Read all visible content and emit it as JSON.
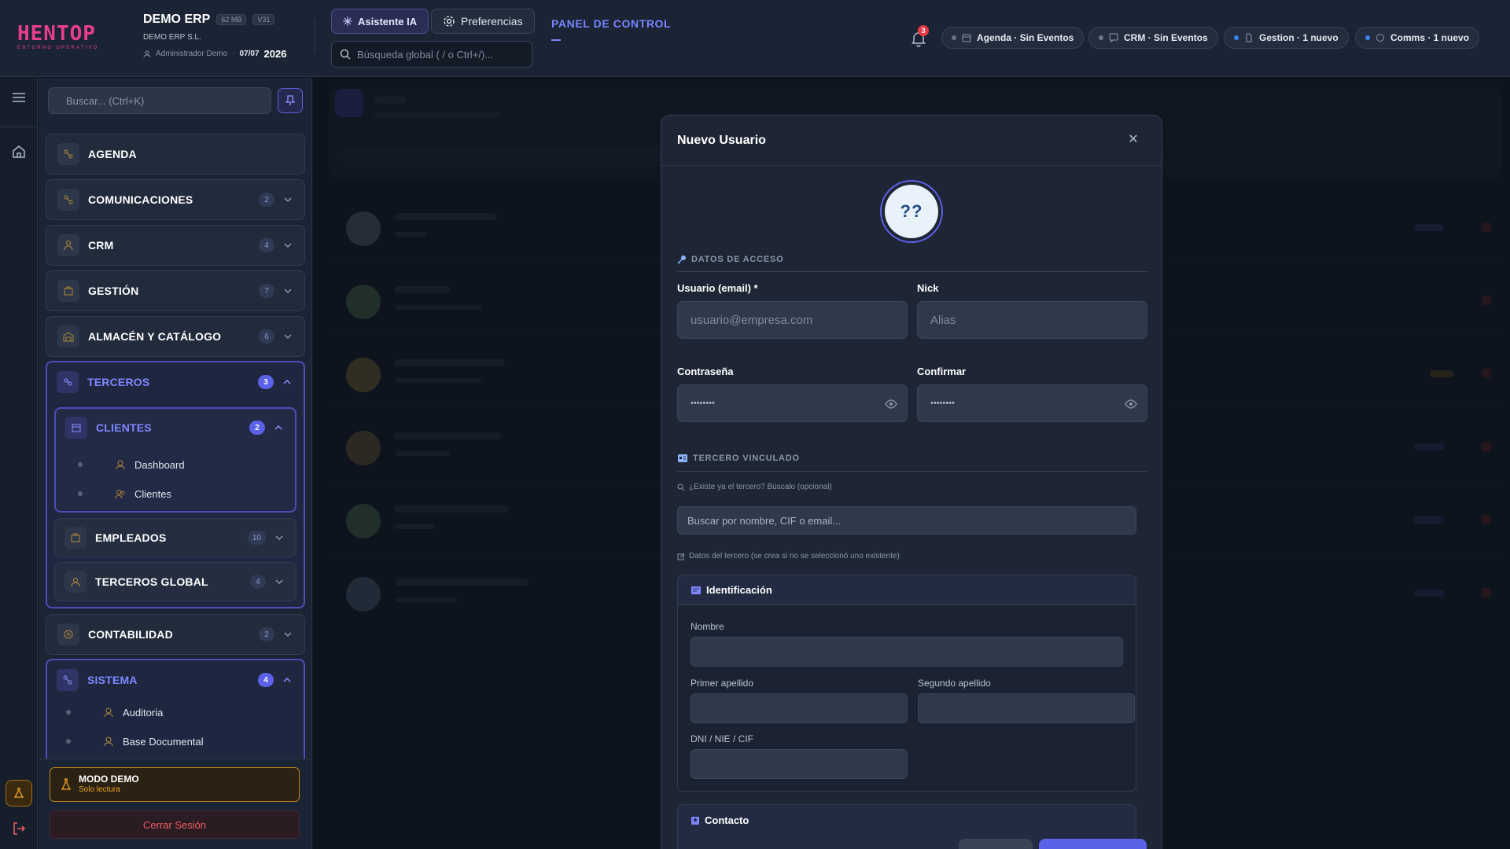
{
  "header": {
    "logo": "HENTOP",
    "logo_sub": "ENTORNO OPERATIVO",
    "app_name": "DEMO ERP",
    "size_tag": "62 MB",
    "version_tag": "V31",
    "company": "DEMO ERP S.L.",
    "user": "Administrador Demo",
    "date": "07/07",
    "year": "2026",
    "ai_button": "Asistente IA",
    "prefs_button": "Preferencias",
    "search_placeholder": "Búsqueda global ( / o Ctrl+/)...",
    "panel_title": "PANEL DE CONTROL",
    "notif_count": "3",
    "pills": [
      {
        "label": "Agenda · Sin Eventos",
        "active": false
      },
      {
        "label": "CRM · Sin Eventos",
        "active": false
      },
      {
        "label": "Gestion · 1 nuevo",
        "active": true
      },
      {
        "label": "Comms · 1 nuevo",
        "active": true
      }
    ]
  },
  "sidebar": {
    "search_placeholder": "Buscar... (Ctrl+K)",
    "items": {
      "agenda": {
        "label": "AGENDA"
      },
      "comunicaciones": {
        "label": "COMUNICACIONES",
        "badge": "2"
      },
      "crm": {
        "label": "CRM",
        "badge": "4"
      },
      "gestion": {
        "label": "GESTIÓN",
        "badge": "7"
      },
      "almacen": {
        "label": "ALMACÉN Y CATÁLOGO",
        "badge": "6"
      },
      "terceros": {
        "label": "TERCEROS",
        "badge": "3"
      },
      "clientes": {
        "label": "CLIENTES",
        "badge": "2"
      },
      "dashboard": {
        "label": "Dashboard"
      },
      "clientes_leaf": {
        "label": "Clientes"
      },
      "empleados": {
        "label": "EMPLEADOS",
        "badge": "10"
      },
      "terceros_global": {
        "label": "TERCEROS GLOBAL",
        "badge": "4"
      },
      "contabilidad": {
        "label": "CONTABILIDAD",
        "badge": "2"
      },
      "sistema": {
        "label": "SISTEMA",
        "badge": "4"
      },
      "auditoria": {
        "label": "Auditoria"
      },
      "base_documental": {
        "label": "Base Documental"
      }
    },
    "demo_title": "MODO DEMO",
    "demo_sub": "Solo lectura",
    "logout": "Cerrar Sesión"
  },
  "modal": {
    "title": "Nuevo Usuario",
    "avatar_initials": "??",
    "section_access": "DATOS DE ACCESO",
    "email_label": "Usuario (email) *",
    "email_placeholder": "usuario@empresa.com",
    "nick_label": "Nick",
    "nick_placeholder": "Alias",
    "password_label": "Contraseña",
    "password_value": "••••••••",
    "confirm_label": "Confirmar",
    "confirm_value": "••••••••",
    "section_third": "TERCERO VINCULADO",
    "third_hint": "¿Existe ya el tercero? Búscalo (opcional)",
    "third_search_placeholder": "Buscar por nombre, CIF o email...",
    "third_data_hint": "Datos del tercero (se crea si no se seleccionó uno existente)",
    "ident_title": "Identificación",
    "nombre_label": "Nombre",
    "apellido1_label": "Primer apellido",
    "apellido2_label": "Segundo apellido",
    "dni_label": "DNI / NIE / CIF",
    "contact_title": "Contacto"
  },
  "colors": {
    "accent": "#5b61e8",
    "brand": "#e83e8c",
    "warning": "#f0a623",
    "danger": "#ef5e66"
  }
}
